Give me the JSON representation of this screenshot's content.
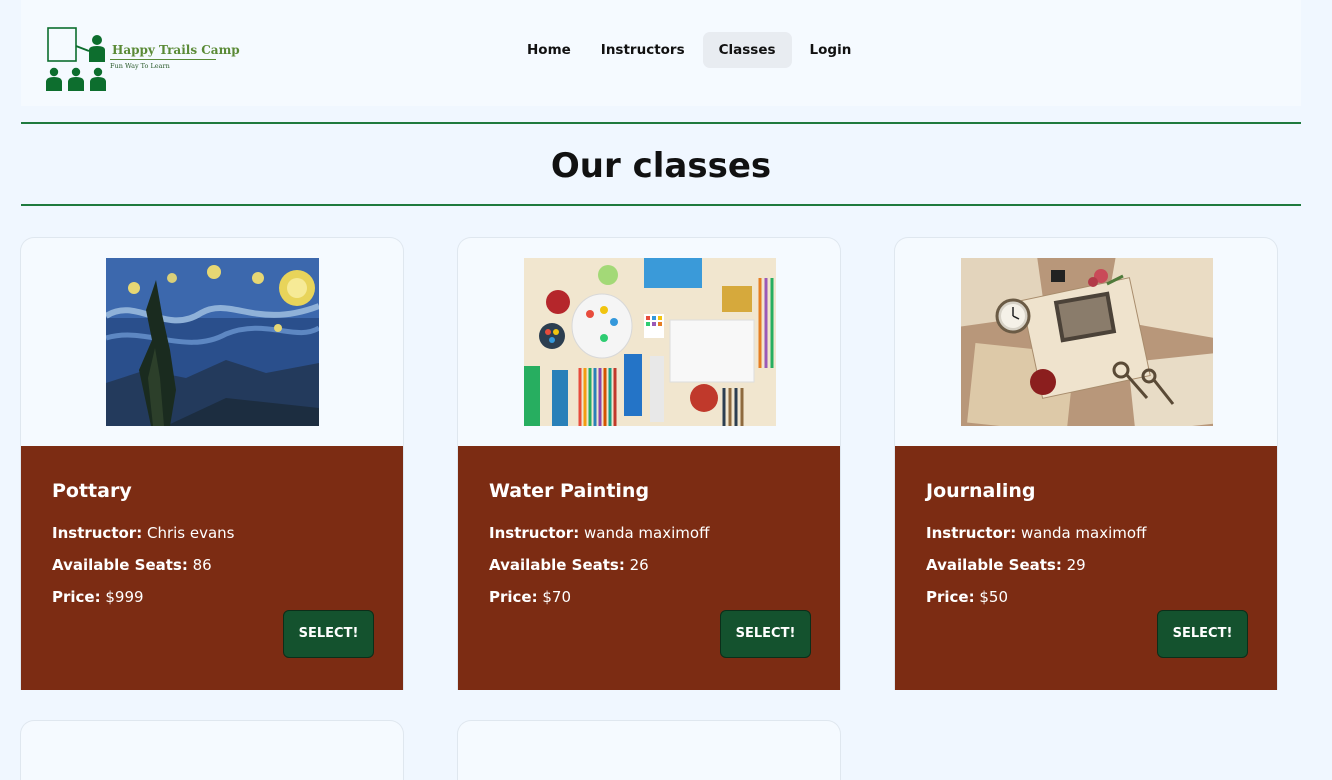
{
  "header": {
    "logo": {
      "name": "Happy Trails Camp",
      "tagline": "Fun Way To Learn"
    },
    "nav": [
      {
        "label": "Home",
        "active": false
      },
      {
        "label": "Instructors",
        "active": false
      },
      {
        "label": "Classes",
        "active": true
      },
      {
        "label": "Login",
        "active": false
      }
    ]
  },
  "main": {
    "title": "Our classes",
    "labels": {
      "instructor": "Instructor:",
      "seats": "Available Seats:",
      "price": "Price:",
      "select": "SELECT!"
    },
    "classes": [
      {
        "name": "Pottary",
        "instructor": "Chris evans",
        "seats": "86",
        "price": "$999",
        "image": "starry-night-painting"
      },
      {
        "name": "Water Painting",
        "instructor": "wanda maximoff",
        "seats": "26",
        "price": "$70",
        "image": "art-supplies-flatlay"
      },
      {
        "name": "Journaling",
        "instructor": "wanda maximoff",
        "seats": "29",
        "price": "$50",
        "image": "vintage-letters-pocket-watch"
      }
    ]
  },
  "colors": {
    "page_bg": "#f0f7ff",
    "accent_green": "#1f7a3e",
    "card_body": "#7c2c13",
    "button": "#14522e",
    "logo_green": "#0d6e2e"
  }
}
